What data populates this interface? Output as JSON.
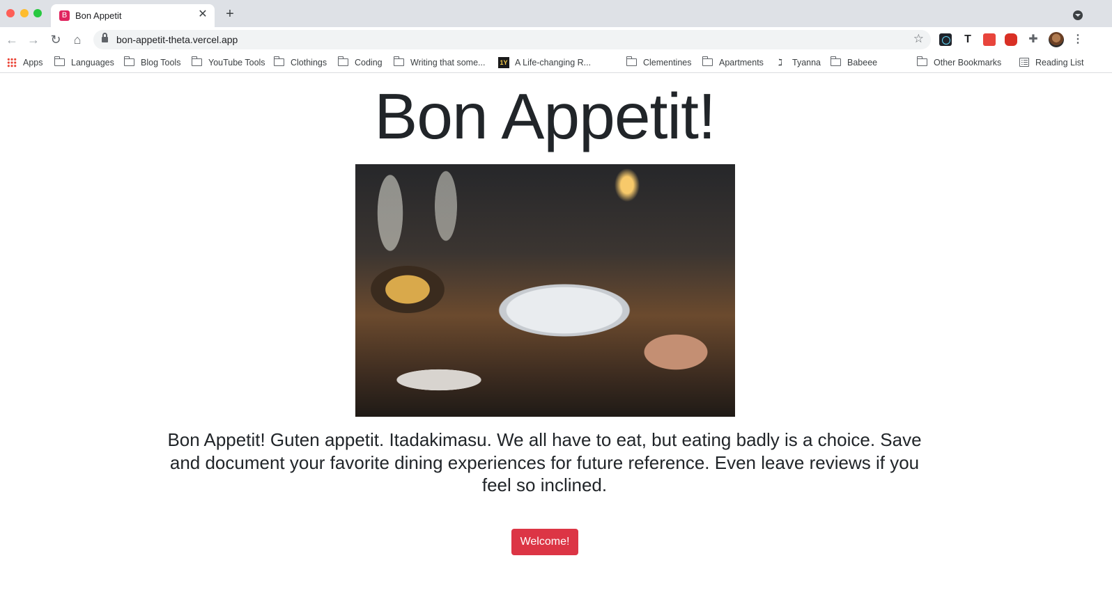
{
  "browser": {
    "tab": {
      "title": "Bon Appetit",
      "favicon_letter": "B",
      "close_glyph": "✕"
    },
    "new_tab_glyph": "+",
    "address_bar": {
      "url": "bon-appetit-theta.vercel.app"
    },
    "nav": {
      "back": "←",
      "forward": "→",
      "reload": "↻",
      "home": "⌂"
    },
    "bookmark_star": "☆",
    "extension_t": "T",
    "extension_puzzle": "✚",
    "menu_glyph": "⋮",
    "overflow_glyph": "»"
  },
  "bookmarks": [
    {
      "label": "Apps",
      "icon": "apps-grid-icon"
    },
    {
      "label": "Languages",
      "icon": "folder-icon"
    },
    {
      "label": "Blog Tools",
      "icon": "folder-icon"
    },
    {
      "label": "YouTube Tools",
      "icon": "folder-icon"
    },
    {
      "label": "Clothings",
      "icon": "folder-icon"
    },
    {
      "label": "Coding",
      "icon": "folder-icon"
    },
    {
      "label": "Writing that some...",
      "icon": "folder-icon"
    },
    {
      "label": "A Life-changing R...",
      "icon": "site-1y-icon",
      "icon_text": "1Y"
    },
    {
      "label": "",
      "icon": "globe-icon"
    },
    {
      "label": "Clementines",
      "icon": "folder-icon"
    },
    {
      "label": "Apartments",
      "icon": "folder-icon"
    },
    {
      "label": "Tyanna",
      "icon": "figure-icon"
    },
    {
      "label": "Babeee",
      "icon": "folder-icon"
    }
  ],
  "other_bookmarks": "Other Bookmarks",
  "reading_list": "Reading List",
  "page": {
    "title": "Bon Appetit!",
    "image_alt": "restaurant-dining-table-photo",
    "description": "Bon Appetit! Guten appetit. Itadakimasu. We all have to eat, but eating badly is a choice. Save and document your favorite dining experiences for future reference. Even leave reviews if you feel so inclined.",
    "cta_label": "Welcome!"
  },
  "colors": {
    "tabstrip_bg": "#dee1e6",
    "cta_bg": "#dc3545",
    "text": "#212529"
  }
}
